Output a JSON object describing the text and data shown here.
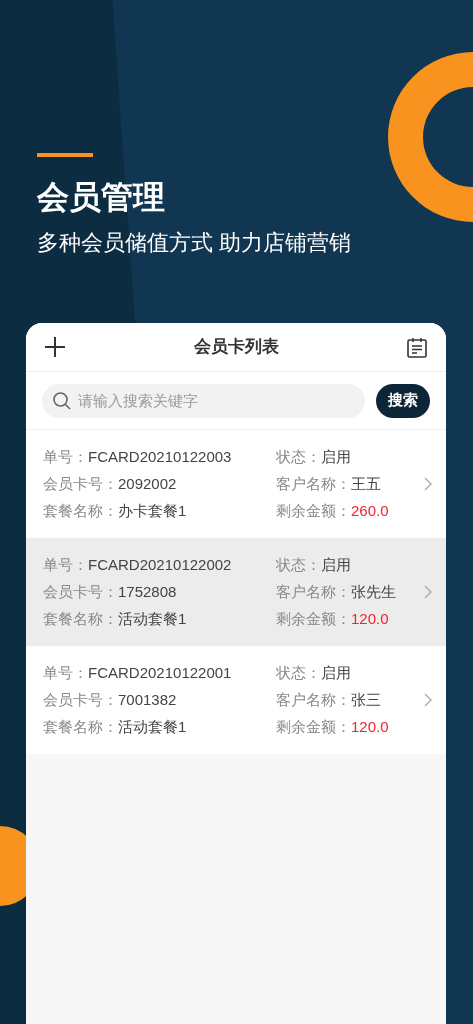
{
  "hero": {
    "title": "会员管理",
    "subtitle": "多种会员储值方式 助力店铺营销"
  },
  "header": {
    "title": "会员卡列表"
  },
  "search": {
    "placeholder": "请输入搜索关键字",
    "button": "搜索"
  },
  "cards": [
    {
      "selected": false,
      "fields": [
        {
          "label": "单号：",
          "value": "FCARD20210122003"
        },
        {
          "label": "状态：",
          "value": "启用"
        },
        {
          "label": "会员卡号：",
          "value": "2092002"
        },
        {
          "label": "客户名称：",
          "value": "王五"
        },
        {
          "label": "套餐名称：",
          "value": "办卡套餐1"
        },
        {
          "label": "剩余金额：",
          "value": "260.0",
          "kind": "amount"
        }
      ]
    },
    {
      "selected": true,
      "fields": [
        {
          "label": "单号：",
          "value": "FCARD20210122002"
        },
        {
          "label": "状态：",
          "value": "启用"
        },
        {
          "label": "会员卡号：",
          "value": "1752808"
        },
        {
          "label": "客户名称：",
          "value": "张先生"
        },
        {
          "label": "套餐名称：",
          "value": "活动套餐1"
        },
        {
          "label": "剩余金额：",
          "value": "120.0",
          "kind": "amount"
        }
      ]
    },
    {
      "selected": false,
      "fields": [
        {
          "label": "单号：",
          "value": "FCARD20210122001"
        },
        {
          "label": "状态：",
          "value": "启用"
        },
        {
          "label": "会员卡号：",
          "value": "7001382"
        },
        {
          "label": "客户名称：",
          "value": "张三"
        },
        {
          "label": "套餐名称：",
          "value": "活动套餐1"
        },
        {
          "label": "剩余金额：",
          "value": "120.0",
          "kind": "amount"
        }
      ]
    }
  ]
}
